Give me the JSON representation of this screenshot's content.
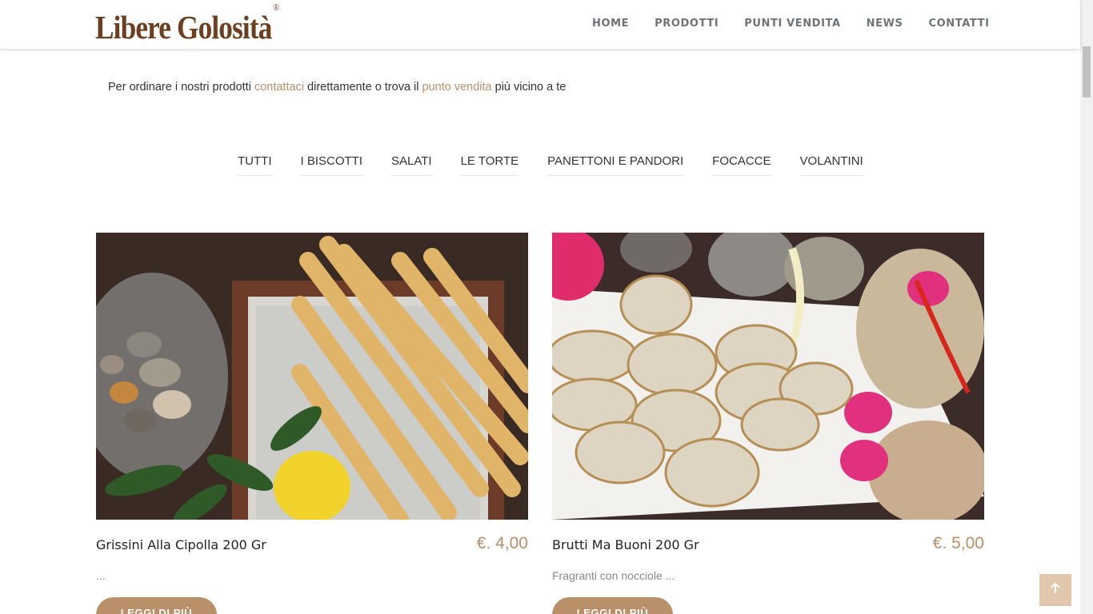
{
  "header": {
    "logo": "Libere Golosità",
    "logo_mark": "®",
    "nav": [
      "HOME",
      "PRODOTTI",
      "PUNTI VENDITA",
      "NEWS",
      "CONTATTI"
    ]
  },
  "intro": {
    "before": "Per ordinare i nostri prodotti ",
    "link1": "contattaci",
    "middle": " direttamente o trova il ",
    "link2": "punto vendita",
    "after": " più vicino a te"
  },
  "filters": [
    "TUTTI",
    "I BISCOTTI",
    "SALATI",
    "LE TORTE",
    "PANETTONI E PANDORI",
    "FOCACCE",
    "VOLANTINI"
  ],
  "products": [
    {
      "title": "Grissini Alla Cipolla 200 Gr",
      "price": "€. 4,00",
      "description": "...",
      "button": "LEGGI DI PIÙ"
    },
    {
      "title": "Brutti Ma Buoni 200 Gr",
      "price": "€. 5,00",
      "description": "Fragranti con nocciole ...",
      "button": "LEGGI DI PIÙ"
    }
  ],
  "colors": {
    "accent": "#b9906a",
    "logo": "#6b3f1f",
    "nav": "#6e7378"
  },
  "icons": {
    "to_top": "arrow-up-icon"
  }
}
